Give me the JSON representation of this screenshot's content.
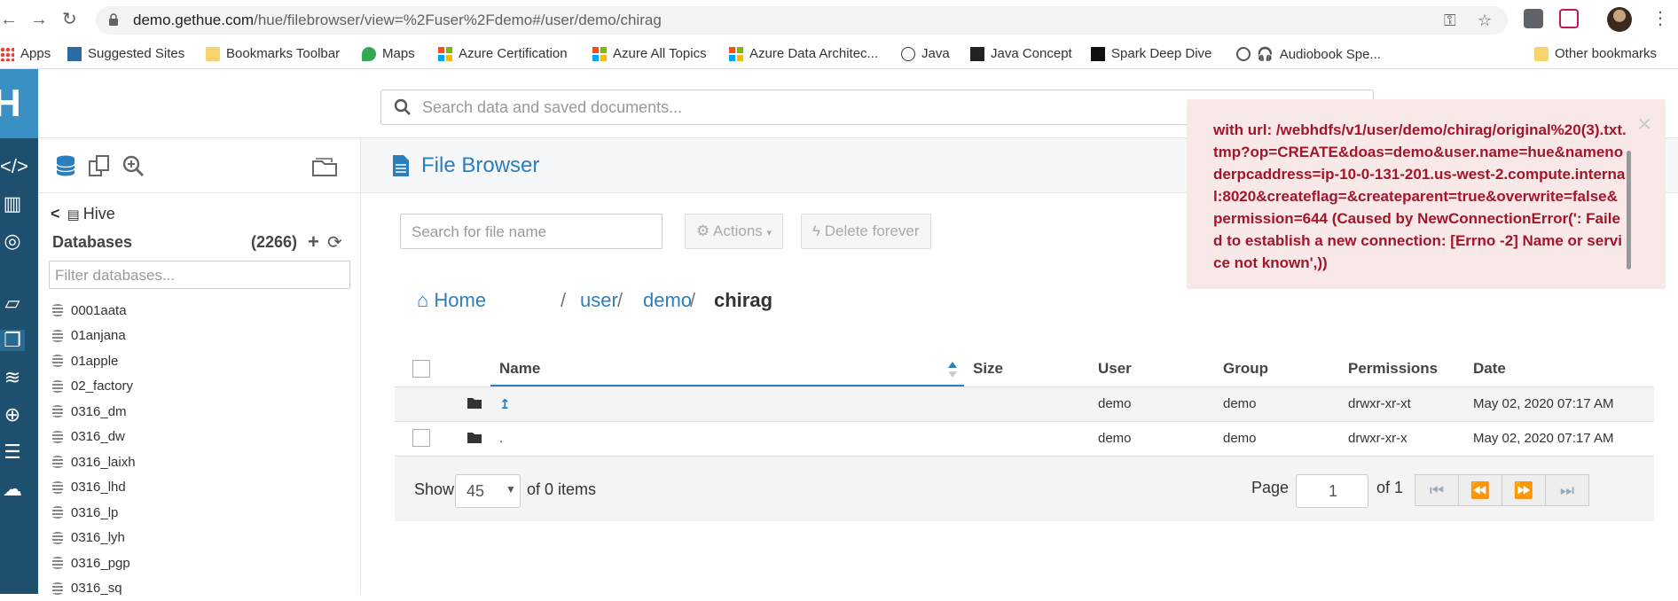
{
  "browser": {
    "url_host": "demo.gethue.com",
    "url_path": "/hue/filebrowser/view=%2Fuser%2Fdemo#/user/demo/chirag",
    "bookmarks": [
      "Apps",
      "Suggested Sites",
      "Bookmarks Toolbar",
      "Maps",
      "Azure Certification",
      "Azure All Topics",
      "Azure Data Architec...",
      "Java",
      "Java Concept",
      "Spark Deep Dive",
      "Audiobook Spe...",
      "Other bookmarks"
    ]
  },
  "topbar": {
    "search_placeholder": "Search data and saved documents..."
  },
  "assist": {
    "back_label": "Hive",
    "databases_label": "Databases",
    "databases_count": "(2266)",
    "filter_placeholder": "Filter databases...",
    "databases": [
      "0001aata",
      "01anjana",
      "01apple",
      "02_factory",
      "0316_dm",
      "0316_dw",
      "0316_laixh",
      "0316_lhd",
      "0316_lp",
      "0316_lyh",
      "0316_pgp",
      "0316_sq"
    ]
  },
  "main": {
    "title": "File Browser",
    "file_search_placeholder": "Search for file name",
    "actions_label": "Actions",
    "delete_label": "Delete forever",
    "breadcrumb": {
      "home": "Home",
      "sep": "/",
      "parts": [
        "user",
        "demo"
      ],
      "current": "chirag"
    },
    "columns": [
      "Name",
      "Size",
      "User",
      "Group",
      "Permissions",
      "Date"
    ],
    "rows": [
      {
        "name": "↥",
        "size": "",
        "user": "demo",
        "group": "demo",
        "permissions": "drwxr-xr-xt",
        "date": "May 02, 2020 07:17 AM"
      },
      {
        "name": ".",
        "size": "",
        "user": "demo",
        "group": "demo",
        "permissions": "drwxr-xr-x",
        "date": "May 02, 2020 07:17 AM"
      }
    ],
    "footer": {
      "show_label": "Show",
      "show_value": "45",
      "items_label": "of 0 items",
      "page_label": "Page",
      "page_value": "1",
      "of_pages": "of 1"
    }
  },
  "error_toast": {
    "message": "with url: /webhdfs/v1/user/demo/chirag/original%20(3).txt.tmp?op=CREATE&doas=demo&user.name=hue&namenoderpcaddress=ip-10-0-131-201.us-west-2.compute.internal:8020&createflag=&createparent=true&overwrite=false&permission=644 (Caused by NewConnectionError(': Failed to establish a new connection: [Errno -2] Name or service not known',))",
    "close_symbol": "×"
  },
  "colors": {
    "accent": "#2a7fbc",
    "leftbar": "#1f4f6f",
    "logo_bg": "#3a8fc4",
    "error_text": "#a3152a",
    "error_bg": "#f9e8e8"
  }
}
